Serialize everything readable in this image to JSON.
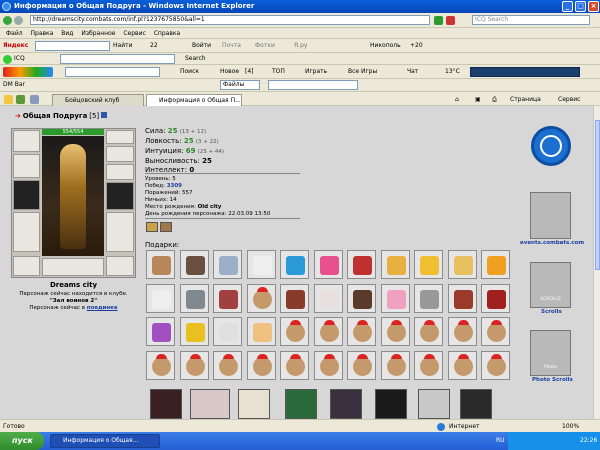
{
  "window": {
    "title": "Информация о Общая Подруга - Windows Internet Explorer",
    "address": "http://dreamscity.combats.com/inf.pl?1237675850&all=1",
    "search_placeholder": "ICQ Search"
  },
  "menu": [
    "Файл",
    "Правка",
    "Вид",
    "Избранное",
    "Сервис",
    "Справка"
  ],
  "toolbar1": {
    "yandex": "Яндекс",
    "find": "Найти",
    "count": "22",
    "login": "Войти",
    "mail": "Почта",
    "photos": "Фотки",
    "yaru": "Я.ру",
    "nikopol": "Никополь",
    "temp1": "+20"
  },
  "toolbar2": {
    "icq": "ICQ",
    "search": "Search"
  },
  "toolbar3": {
    "search": "Поиск",
    "new": "Новое",
    "new_count": "[4]",
    "top": "ТОП",
    "play": "Играть",
    "all_games": "Все Игры",
    "chat": "Чат",
    "temp2": "13°C"
  },
  "toolbar4": {
    "dm": "DM Bar",
    "files": "Файлы"
  },
  "tabs": [
    {
      "label": "Бойцовский клуб"
    },
    {
      "label": "Информация о Общая П..."
    }
  ],
  "tab_tools": {
    "page": "Страница",
    "service": "Сервис"
  },
  "character": {
    "name": "Общая Подруга",
    "level_badge": "[5]",
    "hp": "554/554",
    "city": "Dreams city",
    "location_line1": "Персонаж сейчас находится в клубе.",
    "location_room": "\"Зал воинов 2\"",
    "location_line2_prefix": "Персонаж сейчас в",
    "location_line2_link": "поединке"
  },
  "stats": [
    {
      "label": "Сила:",
      "value": "25",
      "extra": "(13 + 12)"
    },
    {
      "label": "Ловкость:",
      "value": "25",
      "extra": "(3 + 22)"
    },
    {
      "label": "Интуиция:",
      "value": "69",
      "extra": "(25 + 44)"
    },
    {
      "label": "Выносливость:",
      "value": "25",
      "extra": ""
    },
    {
      "label": "Интеллект:",
      "value": "0",
      "extra": ""
    }
  ],
  "info": [
    {
      "label": "Уровень:",
      "value": "5"
    },
    {
      "label": "Побед:",
      "value": "3309"
    },
    {
      "label": "Поражений:",
      "value": "557"
    },
    {
      "label": "Ничьих:",
      "value": "14"
    },
    {
      "label": "Место рождения:",
      "value": "Old city"
    },
    {
      "label": "День рождения персонажа:",
      "value": "22.03.09 13:50"
    }
  ],
  "gifts_label": "Подарки:",
  "side": {
    "events_label": "events.combats.com",
    "scrolls_label": "Scrolls",
    "photo_scrolls_label": "Photo Scrolls",
    "scrolls_img_text": "SCROLLS",
    "photo_img_text": "Photo"
  },
  "status": {
    "done": "Готово",
    "zone": "Интернет",
    "zoom": "100%"
  },
  "taskbar": {
    "start": "пуск",
    "item": "Информация о Общая...",
    "lang": "RU",
    "clock": "22:26"
  }
}
